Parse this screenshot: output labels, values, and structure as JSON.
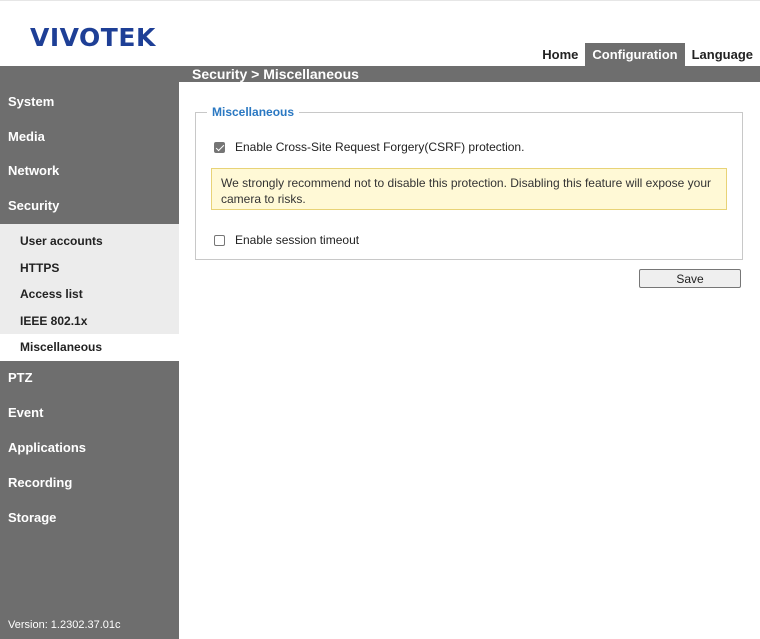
{
  "header": {
    "logo_text": "VIVOTEK",
    "nav": [
      {
        "label": "Home",
        "active": false
      },
      {
        "label": "Configuration",
        "active": true
      },
      {
        "label": "Language",
        "active": false
      }
    ]
  },
  "page_title": "Security  > Miscellaneous",
  "sidebar": {
    "items_top": [
      "System",
      "Media",
      "Network",
      "Security"
    ],
    "submenu": [
      "User accounts",
      "HTTPS",
      "Access list",
      "IEEE 802.1x",
      "Miscellaneous"
    ],
    "submenu_active": "Miscellaneous",
    "items_bottom": [
      "PTZ",
      "Event",
      "Applications",
      "Recording",
      "Storage"
    ],
    "version": "Version: 1.2302.37.01c"
  },
  "section": {
    "legend": "Miscellaneous",
    "csrf_label": "Enable Cross-Site Request Forgery(CSRF) protection.",
    "csrf_checked": true,
    "warning": "We strongly recommend not to disable this protection. Disabling this feature will expose your camera to risks.",
    "session_label": "Enable session timeout",
    "session_checked": false
  },
  "save_label": "Save",
  "colors": {
    "logo": "#1e3f96",
    "sidebar": "#6e6e6e",
    "legend": "#2a78c2",
    "warning_bg": "#fff9d6",
    "warning_border": "#e8d377"
  }
}
